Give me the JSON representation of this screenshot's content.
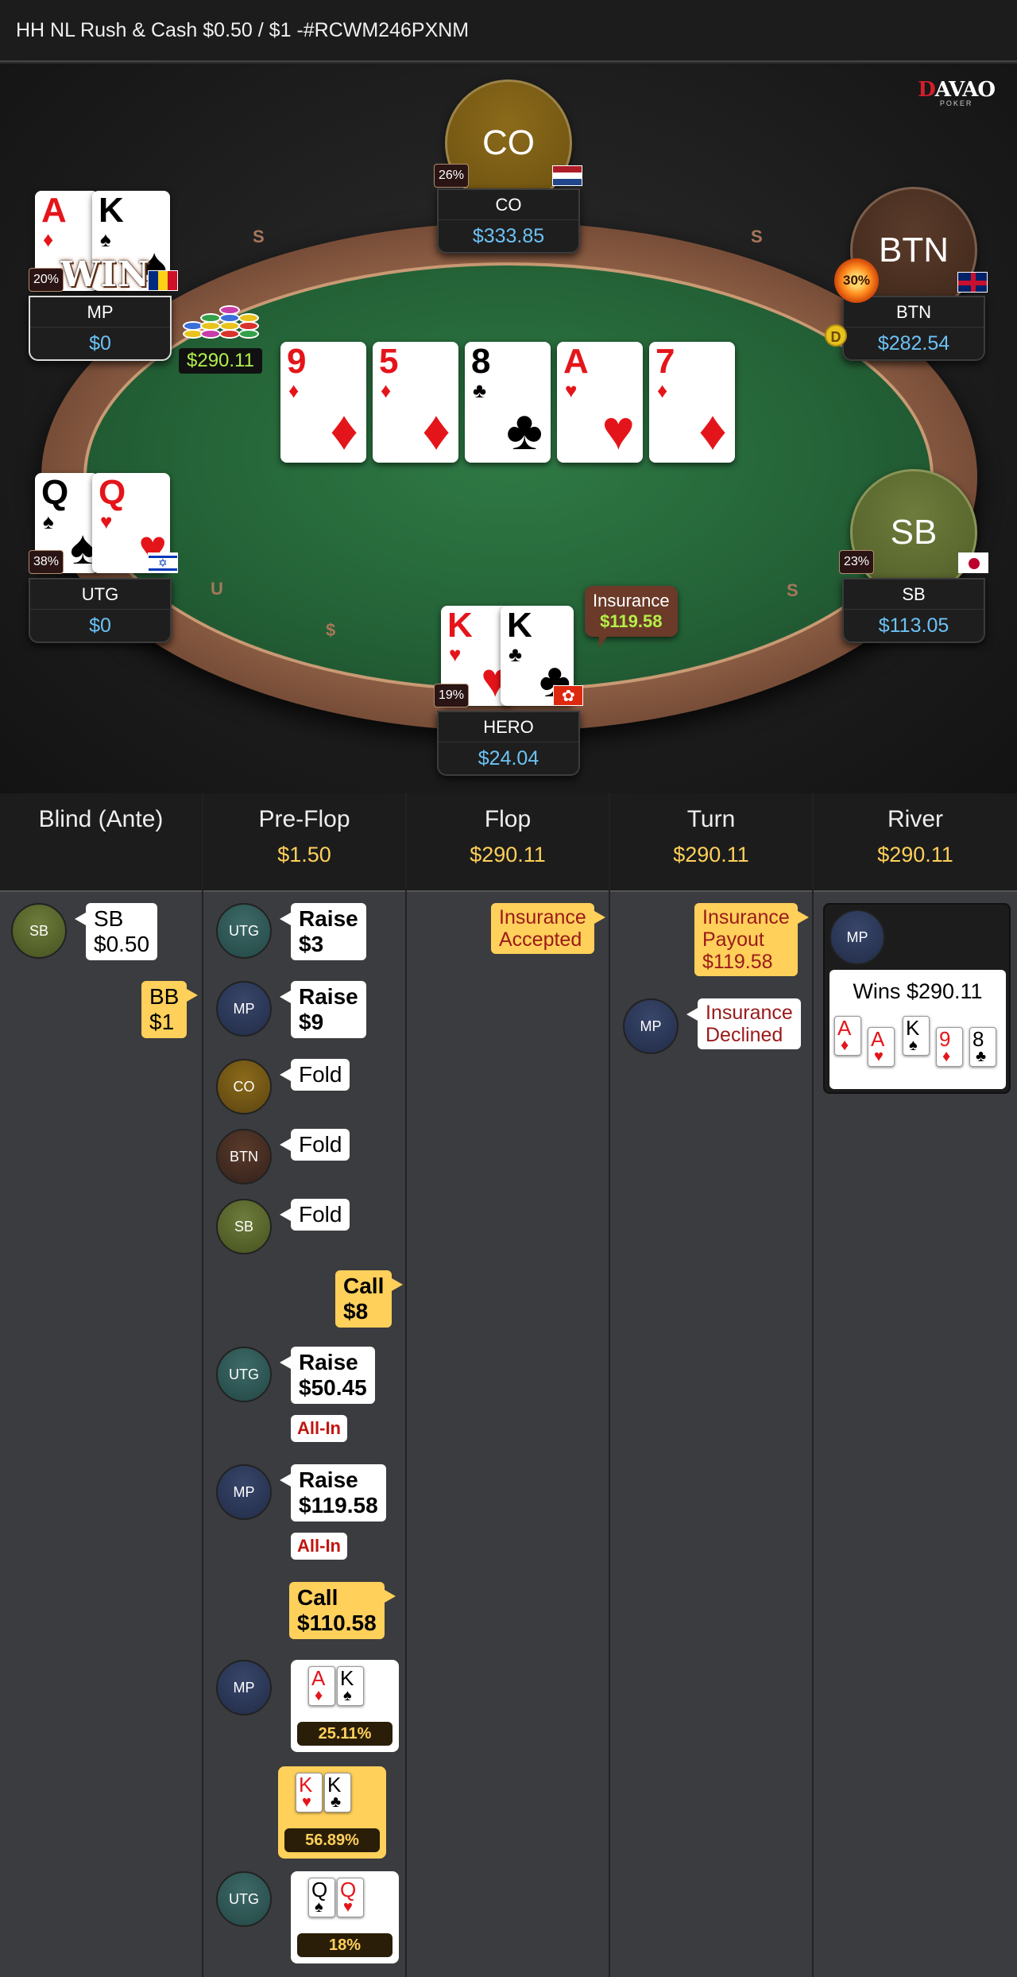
{
  "title": "HH NL Rush & Cash $0.50 / $1 -#RCWM246PXNM",
  "logo": {
    "text": "DAVAO",
    "sub": "POKER"
  },
  "seats": {
    "co": {
      "label": "CO",
      "name": "CO",
      "stack": "$333.85",
      "pct": "26%",
      "flag": "nl"
    },
    "btn": {
      "label": "BTN",
      "name": "BTN",
      "stack": "$282.54",
      "pct": "30%",
      "flag": "gb"
    },
    "mp": {
      "name": "MP",
      "stack": "$0",
      "pct": "20%",
      "flag": "ro",
      "cards": [
        {
          "rank": "A",
          "suit": "♦"
        },
        {
          "rank": "K",
          "suit": "♠"
        }
      ],
      "banner": "WIN"
    },
    "utg": {
      "name": "UTG",
      "stack": "$0",
      "pct": "38%",
      "flag": "il",
      "cards": [
        {
          "rank": "Q",
          "suit": "♠"
        },
        {
          "rank": "Q",
          "suit": "♥"
        }
      ]
    },
    "sb": {
      "label": "SB",
      "name": "SB",
      "stack": "$113.05",
      "pct": "23%",
      "flag": "jp"
    },
    "hero": {
      "name": "HERO",
      "stack": "$24.04",
      "pct": "19%",
      "flag": "hk",
      "cards": [
        {
          "rank": "K",
          "suit": "♥"
        },
        {
          "rank": "K",
          "suit": "♣"
        }
      ]
    }
  },
  "board": [
    {
      "rank": "9",
      "suit": "♦"
    },
    {
      "rank": "5",
      "suit": "♦"
    },
    {
      "rank": "8",
      "suit": "♣"
    },
    {
      "rank": "A",
      "suit": "♥"
    },
    {
      "rank": "7",
      "suit": "♦"
    }
  ],
  "pot": "$290.11",
  "dealer": "D",
  "insurance": {
    "label": "Insurance",
    "value": "$119.58"
  },
  "streets": [
    {
      "name": "Blind (Ante)",
      "pot": ""
    },
    {
      "name": "Pre-Flop",
      "pot": "$1.50"
    },
    {
      "name": "Flop",
      "pot": "$290.11"
    },
    {
      "name": "Turn",
      "pot": "$290.11"
    },
    {
      "name": "River",
      "pot": "$290.11"
    }
  ],
  "blind": {
    "sb_avatar": "SB",
    "sb_action": "SB",
    "sb_amount": "$0.50",
    "bb_action": "BB",
    "bb_amount": "$1"
  },
  "preflop": {
    "utg1": {
      "avatar": "UTG",
      "action": "Raise",
      "amount": "$3"
    },
    "mp1": {
      "avatar": "MP",
      "action": "Raise",
      "amount": "$9"
    },
    "co": {
      "avatar": "CO",
      "action": "Fold"
    },
    "btn": {
      "avatar": "BTN",
      "action": "Fold"
    },
    "sb": {
      "avatar": "SB",
      "action": "Fold"
    },
    "hero_call1": {
      "action": "Call",
      "amount": "$8"
    },
    "utg2": {
      "avatar": "UTG",
      "action": "Raise",
      "amount": "$50.45",
      "tag": "All-In"
    },
    "mp2": {
      "avatar": "MP",
      "action": "Raise",
      "amount": "$119.58",
      "tag": "All-In"
    },
    "hero_call2": {
      "action": "Call",
      "amount": "$110.58"
    },
    "mp_show": {
      "avatar": "MP",
      "cards": [
        {
          "rank": "A",
          "suit": "♦"
        },
        {
          "rank": "K",
          "suit": "♠"
        }
      ],
      "equity": "25.11%"
    },
    "hero_show": {
      "cards": [
        {
          "rank": "K",
          "suit": "♥"
        },
        {
          "rank": "K",
          "suit": "♣"
        }
      ],
      "equity": "56.89%"
    },
    "utg_show": {
      "avatar": "UTG",
      "cards": [
        {
          "rank": "Q",
          "suit": "♠"
        },
        {
          "rank": "Q",
          "suit": "♥"
        }
      ],
      "equity": "18%"
    }
  },
  "flop": {
    "line1": "Insurance",
    "line2": "Accepted"
  },
  "turn": {
    "payout": {
      "line1": "Insurance",
      "line2": "Payout",
      "amount": "$119.58"
    },
    "mp_avatar": "MP",
    "declined": {
      "line1": "Insurance",
      "line2": "Declined"
    }
  },
  "river": {
    "avatar": "MP",
    "wins": "Wins $290.11",
    "cards": [
      {
        "rank": "A",
        "suit": "♦"
      },
      {
        "rank": "A",
        "suit": "♥"
      },
      {
        "rank": "K",
        "suit": "♠"
      },
      {
        "rank": "9",
        "suit": "♦"
      },
      {
        "rank": "8",
        "suit": "♣"
      }
    ]
  }
}
